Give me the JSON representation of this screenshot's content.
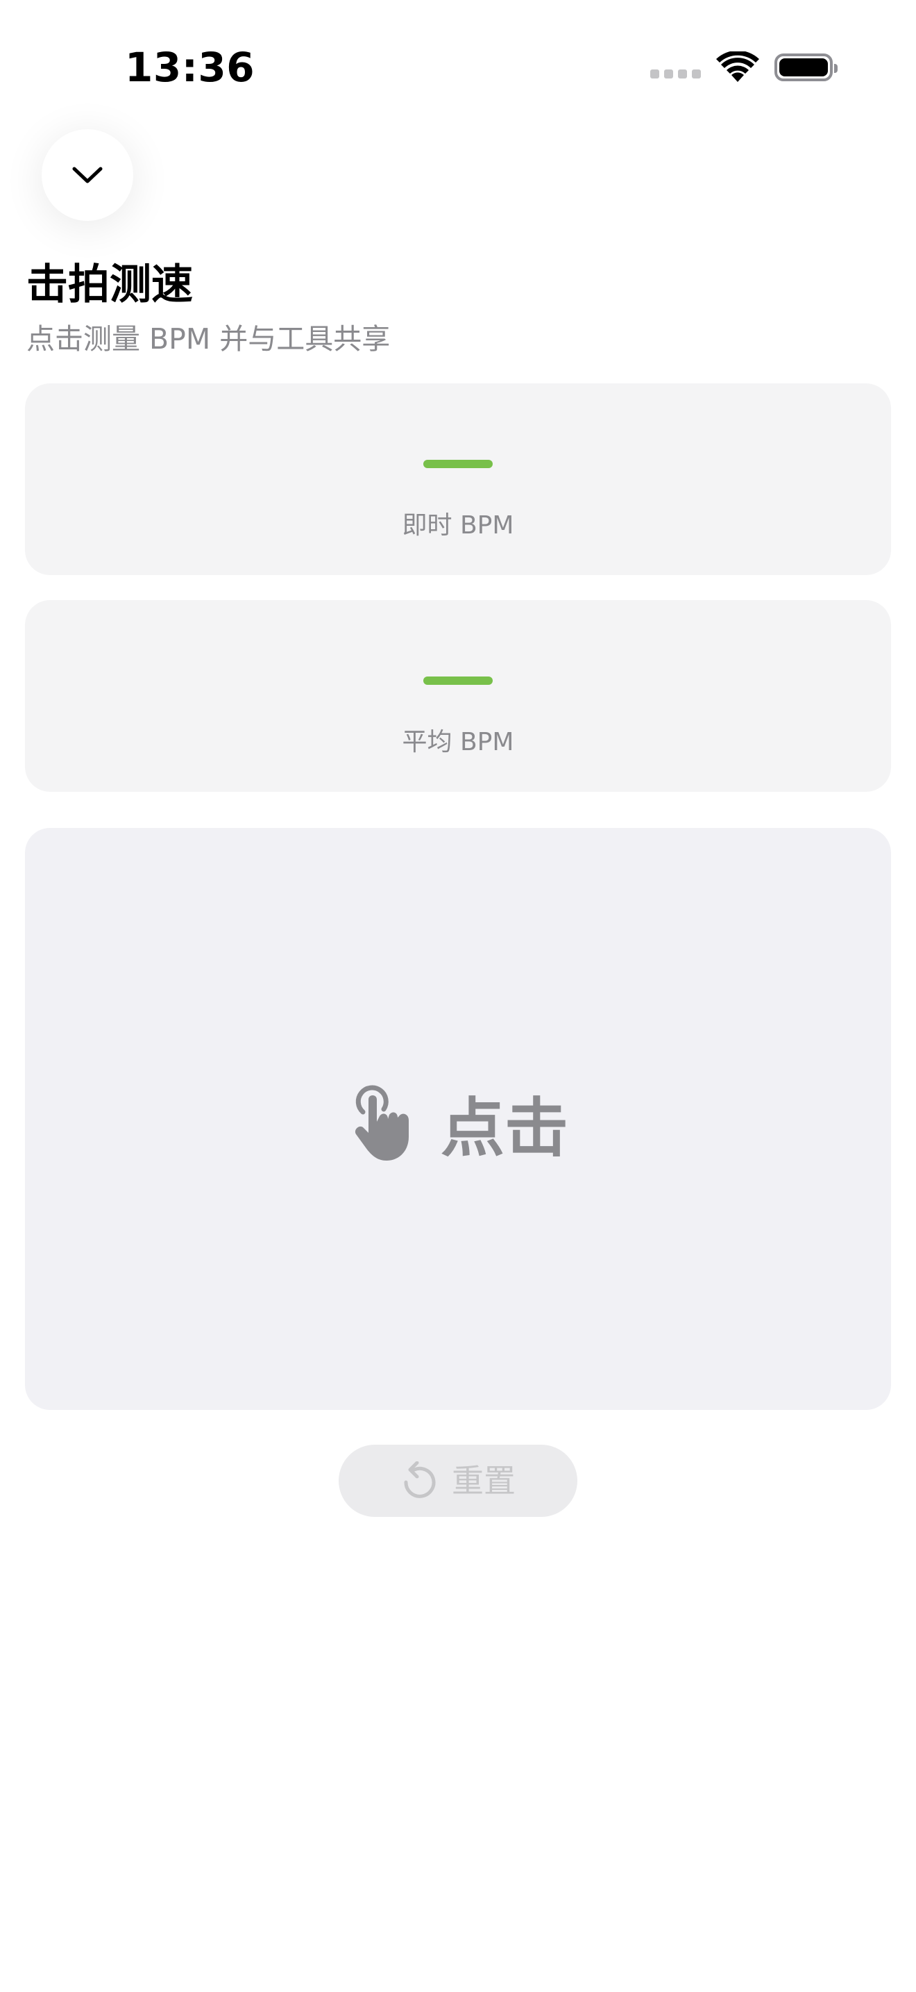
{
  "status_bar": {
    "time": "13:36"
  },
  "header": {
    "title": "击拍测速",
    "subtitle": "点击测量 BPM 并与工具共享"
  },
  "stats": [
    {
      "label": "即时 BPM",
      "value": "—"
    },
    {
      "label": "平均 BPM",
      "value": "—"
    }
  ],
  "tap_area": {
    "label": "点击",
    "icon": "hand-tap-icon"
  },
  "reset_button": {
    "label": "重置",
    "icon": "counterclockwise-arrow-icon",
    "enabled": false
  },
  "colors": {
    "accent": "#78c04a",
    "card_bg": "#f4f4f5",
    "tap_bg": "#f1f1f5",
    "secondary_text": "#8a8a8e"
  }
}
